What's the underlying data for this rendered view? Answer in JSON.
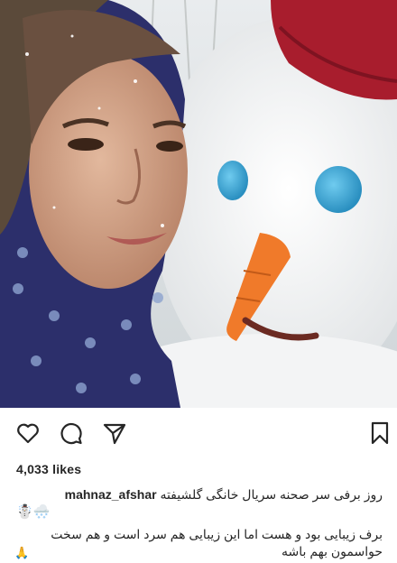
{
  "post": {
    "likes": "4,033 likes",
    "username": "mahnaz_afshar",
    "caption_line1": "روز برفی سر صحنه  سریال خانگی گلشیفته",
    "caption_emoji": "☃️🌨️",
    "caption_body": "برف زیبایی بود و هست اما این زیبایی هم سرد است و هم سخت حواسمون بهم باشه",
    "caption_end_emoji": "🙏"
  },
  "actions": {
    "like_icon": "heart-outline-icon",
    "comment_icon": "comment-bubble-icon",
    "share_icon": "paper-plane-icon",
    "save_icon": "bookmark-icon"
  },
  "colors": {
    "text": "#262626",
    "snowman_eye": "#39a7d6",
    "carrot_nose": "#f07a2a",
    "hat": "#a81d2d",
    "scarf": "#2c2f6b"
  }
}
